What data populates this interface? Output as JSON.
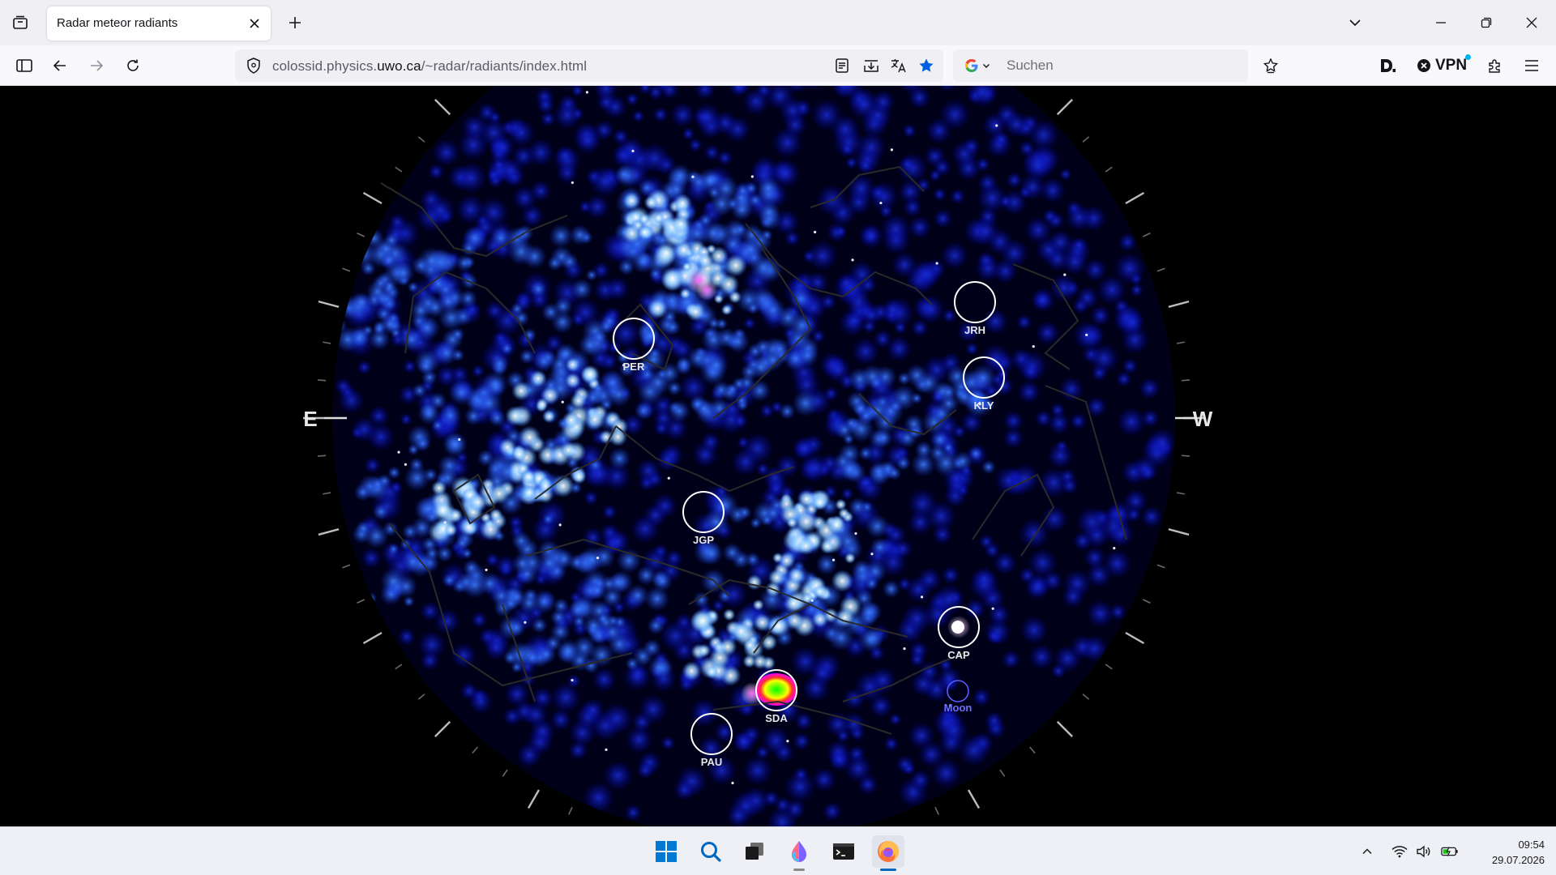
{
  "browser": {
    "tab": {
      "title": "Radar meteor radiants"
    },
    "url": {
      "prefix": "colossid.physics.",
      "host": "uwo.ca",
      "path": "/~radar/radiants/index.html"
    },
    "search": {
      "placeholder": "Suchen",
      "engine": "google-icon"
    },
    "vpn_label": "VPN",
    "colors": {
      "accent": "#0061e0",
      "bookmark_star": "#0061e0"
    }
  },
  "sky_map": {
    "directions": {
      "east": "E",
      "west": "W"
    },
    "radiants": [
      {
        "label": "PER",
        "kind": "shower"
      },
      {
        "label": "JRH",
        "kind": "shower"
      },
      {
        "label": "KLY",
        "kind": "shower"
      },
      {
        "label": "JGP",
        "kind": "shower"
      },
      {
        "label": "CAP",
        "kind": "shower",
        "intensity": "high"
      },
      {
        "label": "SDA",
        "kind": "shower",
        "intensity": "peak"
      },
      {
        "label": "PAU",
        "kind": "shower"
      },
      {
        "label": "Moon",
        "kind": "moon"
      }
    ],
    "colors": {
      "background": "#000000",
      "density_low": "#0000a0",
      "density_mid": "#3c7cff",
      "density_high": "#ffffff",
      "peak": "#ff00ff",
      "moon_label": "#6e6eff"
    }
  },
  "taskbar": {
    "apps": [
      "start-icon",
      "search-icon",
      "task-view-icon",
      "paint-icon",
      "terminal-icon",
      "firefox-icon"
    ],
    "clock": {
      "time": "09:54",
      "date": "29.07.2026"
    }
  }
}
